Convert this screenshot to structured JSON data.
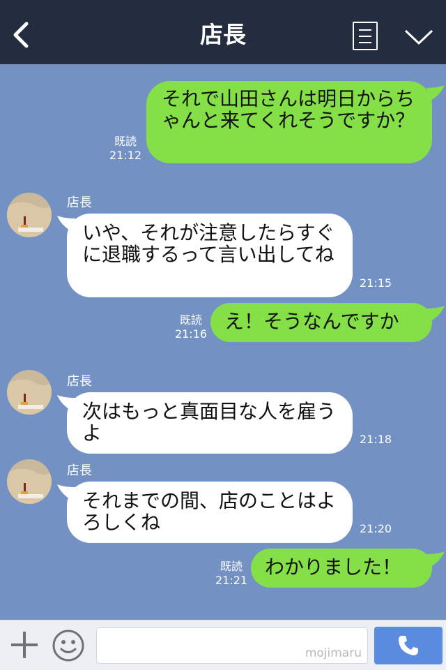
{
  "header": {
    "title": "店長"
  },
  "messages": [
    {
      "from": "me",
      "text": "それで山田さんは明日からちゃんと来てくれそうですか？",
      "read": "既読",
      "time": "21:12"
    },
    {
      "from": "them",
      "sender": "店長",
      "text": "いや、それが注意したらすぐに退職するって言い出してね",
      "time": "21:15"
    },
    {
      "from": "me",
      "text": "え！そうなんですか",
      "read": "既読",
      "time": "21:16"
    },
    {
      "from": "them",
      "sender": "店長",
      "text": "次はもっと真面目な人を雇うよ",
      "time": "21:18"
    },
    {
      "from": "them",
      "sender": "店長",
      "text": "それまでの間、店のことはよろしくね",
      "time": "21:20"
    },
    {
      "from": "me",
      "text": "わかりました！",
      "read": "既読",
      "time": "21:21"
    }
  ],
  "footer": {
    "watermark": "mojimaru",
    "icons": [
      "plus-icon",
      "smiley-icon",
      "phone-icon"
    ]
  },
  "colors": {
    "background": "#7391c3",
    "header": "#242c40",
    "my_bubble": "#84e046",
    "their_bubble": "#ffffff",
    "call_button": "#5a8bdf"
  }
}
